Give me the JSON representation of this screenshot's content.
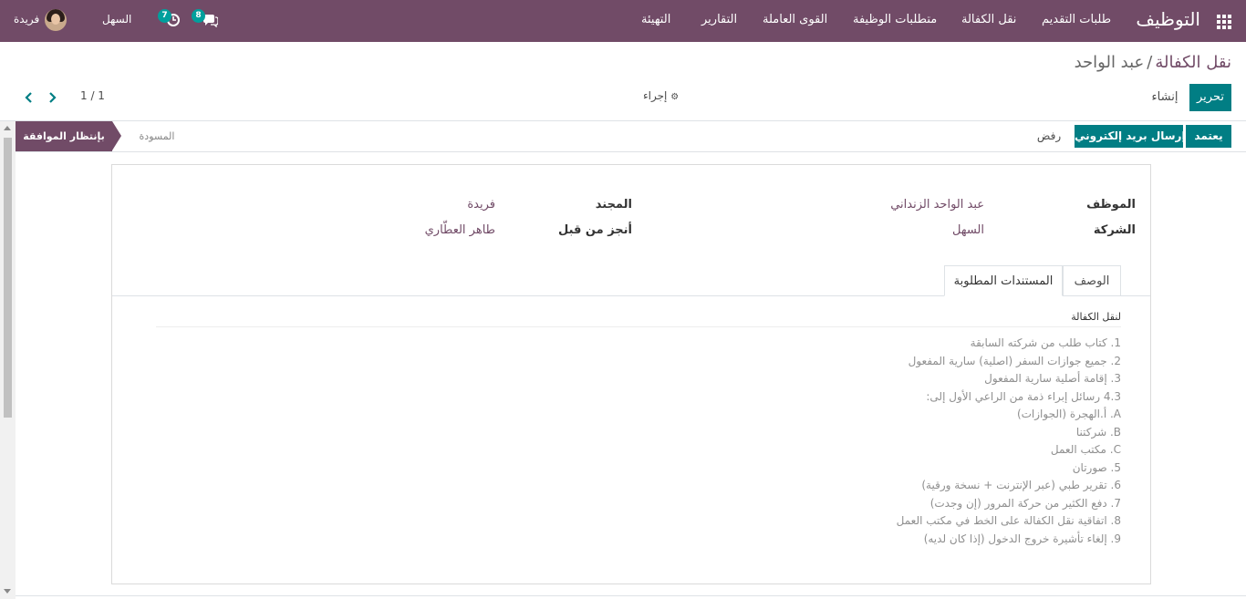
{
  "navbar": {
    "app_title": "التوظيف",
    "menu": [
      "طلبات التقديم",
      "نقل الكفالة",
      "متطلبات الوظيفة",
      "القوى العاملة",
      "التقارير",
      "التهيئة"
    ],
    "messages_count": "8",
    "activities_count": "7",
    "company": "السهل",
    "user": "فريدة"
  },
  "control_panel": {
    "breadcrumb_parent": "نقل الكفالة",
    "breadcrumb_separator": "/",
    "breadcrumb_current": "عبد الواحد",
    "edit_label": "تحرير",
    "create_label": "إنشاء",
    "action_label": "إجراء",
    "pager": "1 / 1"
  },
  "statusbar": {
    "approve_label": "يعتمد",
    "send_email_label": "إرسال بريد إلكتروني",
    "refuse_label": "رفض",
    "stages": [
      "بإنتظار الموافقة",
      "المسودة"
    ],
    "active_stage": "بإنتظار الموافقة"
  },
  "form": {
    "employee_label": "الموظف",
    "employee_value": "عبد الواحد الزنداني",
    "company_label": "الشركة",
    "company_value": "السهل",
    "recruiter_label": "المجند",
    "recruiter_value": "فريدة",
    "done_by_label": "أنجز من قبل",
    "done_by_value": "طاهر العطّاري",
    "tabs": [
      "الوصف",
      "المستندات المطلوبة"
    ],
    "active_tab": "المستندات المطلوبة",
    "documents_title": "لنقل الكفالة",
    "documents": [
      "1. كتاب طلب من شركته السابقة",
      "2. جميع جوازات السفر (اصلية) سارية المفعول",
      "3. إقامة أصلية سارية المفعول",
      "4.3 رسائل إبراء ذمة من الراعي الأول إلى:",
      "A. أ.الهجرة (الجوازات)",
      "B. شركتنا",
      "C. مكتب العمل",
      "5. صورتان",
      "6. تقرير طبي (عبر الإنترنت + نسخة ورقية)",
      "7. دفع الكثير من حركة المرور (إن وجدت)",
      "8. اتفاقية نقل الكفالة على الخط في مكتب العمل",
      "9. إلغاء تأشيرة خروج الدخول (إذا كان لديه)"
    ]
  },
  "colors": {
    "brand": "#714b67",
    "primary": "#017e84",
    "badge": "#00a09d"
  }
}
